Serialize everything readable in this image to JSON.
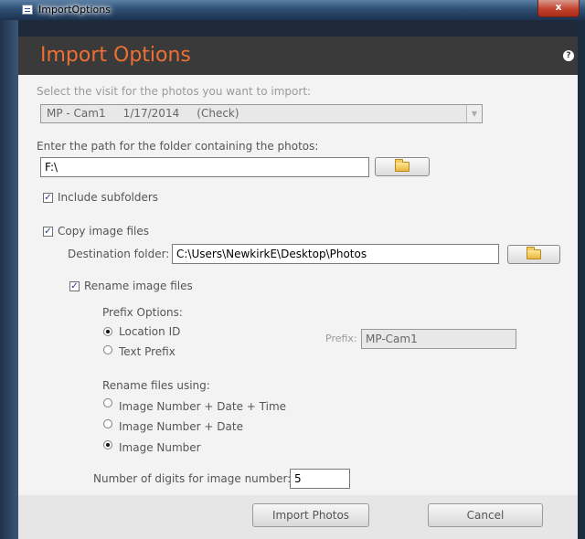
{
  "window": {
    "title": "ImportOptions",
    "close_label": "x"
  },
  "header": {
    "title": "Import Options",
    "help_icon": "?"
  },
  "visit": {
    "label": "Select the visit for the photos you want to import:",
    "selected": "MP - Cam1     1/17/2014     (Check)"
  },
  "folder": {
    "label": "Enter the path for the folder containing the photos:",
    "value": "F:\\"
  },
  "include_subfolders": {
    "label": "Include subfolders",
    "checked": true
  },
  "copy_images": {
    "label": "Copy image files",
    "checked": true,
    "destination_label": "Destination folder:",
    "destination_value": "C:\\Users\\NewkirkE\\Desktop\\Photos"
  },
  "rename": {
    "label": "Rename image files",
    "checked": true,
    "prefix_options_label": "Prefix Options:",
    "prefix_options": [
      {
        "label": "Location ID",
        "selected": true
      },
      {
        "label": "Text Prefix",
        "selected": false
      }
    ],
    "prefix_label": "Prefix:",
    "prefix_value": "MP-Cam1",
    "using_label": "Rename files using:",
    "using_options": [
      {
        "label": "Image Number + Date + Time",
        "selected": false
      },
      {
        "label": "Image Number + Date",
        "selected": false
      },
      {
        "label": "Image Number",
        "selected": true
      }
    ]
  },
  "digits": {
    "label": "Number of digits for image number:",
    "value": "5"
  },
  "footer": {
    "import_label": "Import Photos",
    "cancel_label": "Cancel"
  },
  "colors": {
    "header_bg": "#3a3a3a",
    "header_text": "#ee7033"
  }
}
